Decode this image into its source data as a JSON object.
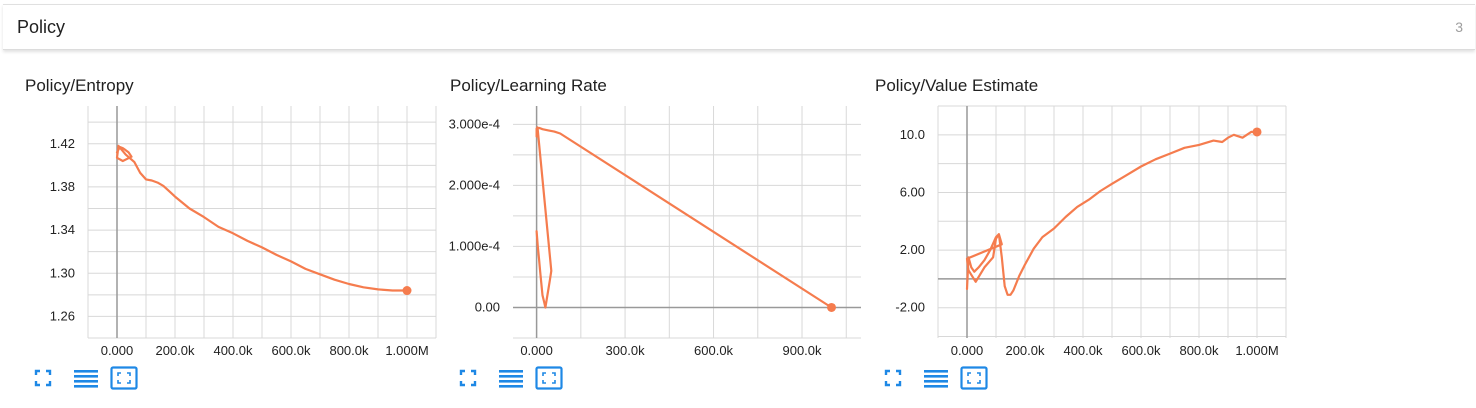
{
  "section": {
    "title": "Policy",
    "count": "3"
  },
  "colors": {
    "line": "#f57c4e",
    "accent": "#1e88e5",
    "grid": "#d8d8d8",
    "axis": "#999999"
  },
  "icons": [
    "fit-domain-icon",
    "toggle-log-scale-icon",
    "expand-chart-icon"
  ],
  "charts": [
    {
      "title": "Policy/Entropy",
      "xticks": [
        "0.000",
        "200.0k",
        "400.0k",
        "600.0k",
        "800.0k",
        "1.000M"
      ],
      "yticks": [
        "1.42",
        "1.38",
        "1.34",
        "1.30",
        "1.26"
      ]
    },
    {
      "title": "Policy/Learning Rate",
      "xticks": [
        "0.000",
        "300.0k",
        "600.0k",
        "900.0k"
      ],
      "yticks": [
        "3.000e-4",
        "2.000e-4",
        "1.000e-4",
        "0.00"
      ]
    },
    {
      "title": "Policy/Value Estimate",
      "xticks": [
        "0.000",
        "200.0k",
        "400.0k",
        "600.0k",
        "800.0k",
        "1.000M"
      ],
      "yticks": [
        "10.0",
        "6.00",
        "2.00",
        "-2.00"
      ]
    }
  ],
  "chart_data": [
    {
      "type": "line",
      "title": "Policy/Entropy",
      "xlim": [
        -100000,
        1100000
      ],
      "ylim": [
        1.24,
        1.455
      ],
      "series": [
        {
          "x": [
            0,
            10000,
            20000,
            30000,
            40000,
            50000,
            20000,
            0,
            5000,
            30000,
            60000,
            80000,
            100000,
            120000,
            140000,
            160000,
            180000,
            200000,
            250000,
            300000,
            350000,
            400000,
            450000,
            500000,
            550000,
            600000,
            650000,
            700000,
            750000,
            800000,
            850000,
            900000,
            950000,
            1000000
          ],
          "y": [
            1.412,
            1.417,
            1.416,
            1.414,
            1.412,
            1.408,
            1.404,
            1.407,
            1.418,
            1.41,
            1.403,
            1.393,
            1.387,
            1.386,
            1.384,
            1.381,
            1.376,
            1.371,
            1.36,
            1.352,
            1.343,
            1.337,
            1.33,
            1.324,
            1.317,
            1.311,
            1.304,
            1.299,
            1.294,
            1.29,
            1.287,
            1.285,
            1.284,
            1.284
          ]
        }
      ]
    },
    {
      "type": "line",
      "title": "Policy/Learning Rate",
      "xlim": [
        -80000,
        1100000
      ],
      "ylim": [
        -5e-05,
        0.00033
      ],
      "series": [
        {
          "x": [
            0,
            4000,
            8000,
            12000,
            16000,
            20000,
            25000,
            30000,
            35000,
            40000,
            45000,
            50000,
            3000,
            0,
            0,
            10000,
            20000,
            40000,
            60000,
            80000,
            1000000
          ],
          "y": [
            0.000125,
            0.0001,
            8e-05,
            6e-05,
            4e-05,
            2e-05,
            1e-05,
            0.0,
            1.5e-05,
            3e-05,
            4.5e-05,
            6e-05,
            0.000295,
            0.00028,
            0.000293,
            0.000294,
            0.000292,
            0.00029,
            0.000288,
            0.000285,
            0.0
          ]
        }
      ]
    },
    {
      "type": "line",
      "title": "Policy/Value Estimate",
      "xlim": [
        -100000,
        1100000
      ],
      "ylim": [
        -4.1,
        12.0
      ],
      "series": [
        {
          "x": [
            0,
            5000,
            15000,
            25000,
            40000,
            60000,
            80000,
            100000,
            110000,
            120000,
            0,
            5000,
            30000,
            60000,
            90000,
            100000,
            110000,
            120000,
            130000,
            140000,
            150000,
            160000,
            180000,
            200000,
            230000,
            260000,
            300000,
            340000,
            380000,
            420000,
            460000,
            500000,
            550000,
            600000,
            650000,
            700000,
            750000,
            800000,
            850000,
            880000,
            900000,
            920000,
            950000,
            980000,
            1000000
          ],
          "y": [
            -0.7,
            1.5,
            0.8,
            0.5,
            0.8,
            1.3,
            2.0,
            2.9,
            3.1,
            2.4,
            1.4,
            0.6,
            -0.2,
            0.8,
            1.5,
            2.8,
            3.1,
            1.5,
            -0.5,
            -1.1,
            -1.1,
            -0.8,
            0.2,
            1.0,
            2.1,
            2.9,
            3.5,
            4.3,
            5.0,
            5.5,
            6.1,
            6.6,
            7.2,
            7.8,
            8.3,
            8.7,
            9.1,
            9.3,
            9.6,
            9.5,
            9.8,
            10.0,
            9.8,
            10.2,
            10.2
          ]
        }
      ]
    }
  ]
}
